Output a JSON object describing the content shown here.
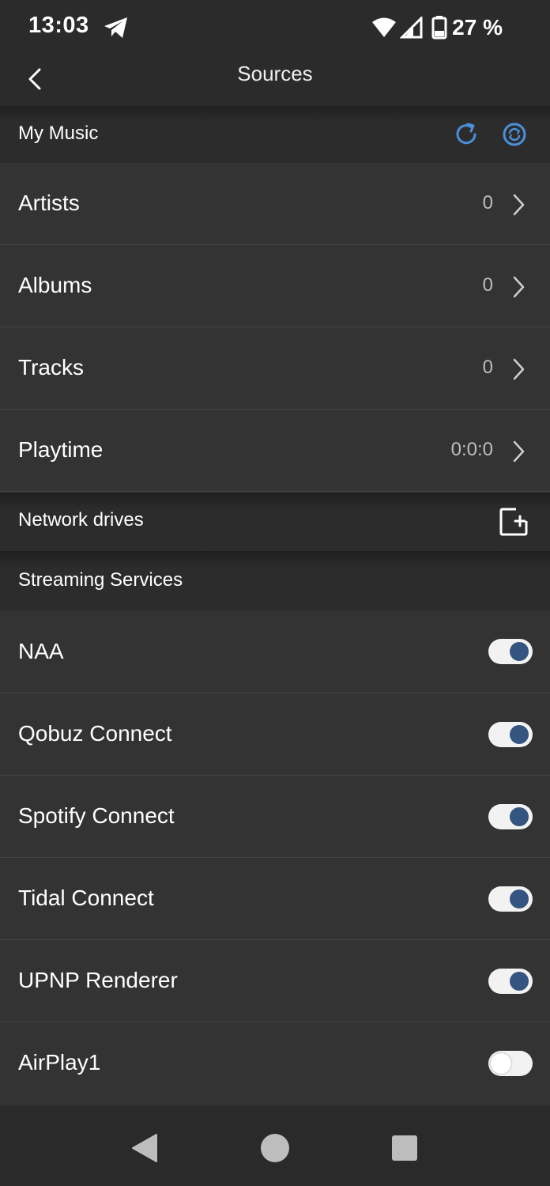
{
  "status_bar": {
    "time": "13:03",
    "battery": "27 %",
    "icons": [
      "telegram-icon",
      "wifi-icon",
      "signal-icon",
      "battery-icon"
    ]
  },
  "header": {
    "title": "Sources",
    "back_icon": "chevron-left-icon"
  },
  "my_music": {
    "label": "My Music",
    "actions": [
      "sync-icon",
      "sync-circle-icon"
    ],
    "items": [
      {
        "label": "Artists",
        "value": "0"
      },
      {
        "label": "Albums",
        "value": "0"
      },
      {
        "label": "Tracks",
        "value": "0"
      },
      {
        "label": "Playtime",
        "value": "0:0:0"
      }
    ]
  },
  "network_drives": {
    "label": "Network drives",
    "action": "add-drive-icon"
  },
  "streaming": {
    "label": "Streaming Services",
    "items": [
      {
        "label": "NAA",
        "enabled": true
      },
      {
        "label": "Qobuz Connect",
        "enabled": true
      },
      {
        "label": "Spotify Connect",
        "enabled": true
      },
      {
        "label": "Tidal Connect",
        "enabled": true
      },
      {
        "label": "UPNP Renderer",
        "enabled": true
      },
      {
        "label": "AirPlay1",
        "enabled": false
      }
    ]
  },
  "colors": {
    "accent": "#4a90d9",
    "toggle_knob_on": "#34557f",
    "background": "#333333"
  },
  "nav_bar": {
    "icons": [
      "back-triangle-icon",
      "home-circle-icon",
      "recents-square-icon"
    ]
  }
}
